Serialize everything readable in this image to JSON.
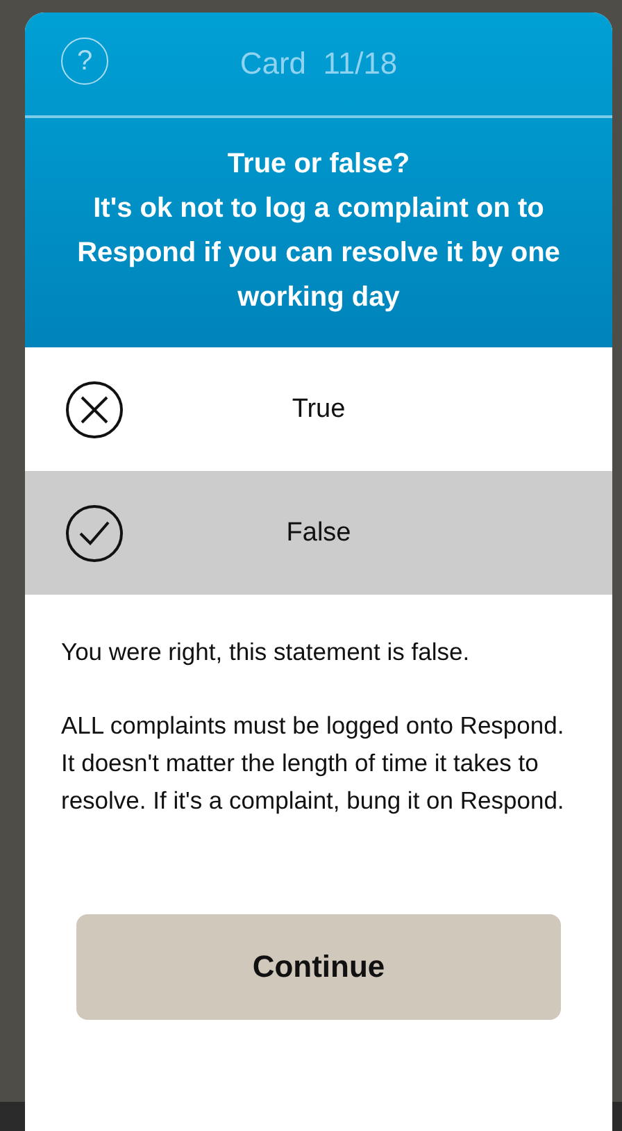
{
  "header": {
    "help": "?",
    "title": "Card  11/18"
  },
  "question": {
    "lines": [
      "True or false?",
      "It's ok not to log a complaint on to Respond if you can resolve it by one working day"
    ]
  },
  "options": [
    {
      "label": "True",
      "kind": "cross",
      "selected": false
    },
    {
      "label": "False",
      "kind": "check",
      "selected": true
    }
  ],
  "feedback": [
    "You were right, this statement is false.",
    "ALL complaints must be logged onto Respond. It doesn't matter the length of time it takes to resolve. If it's a complaint, bung it on Respond."
  ],
  "button": "Continue"
}
